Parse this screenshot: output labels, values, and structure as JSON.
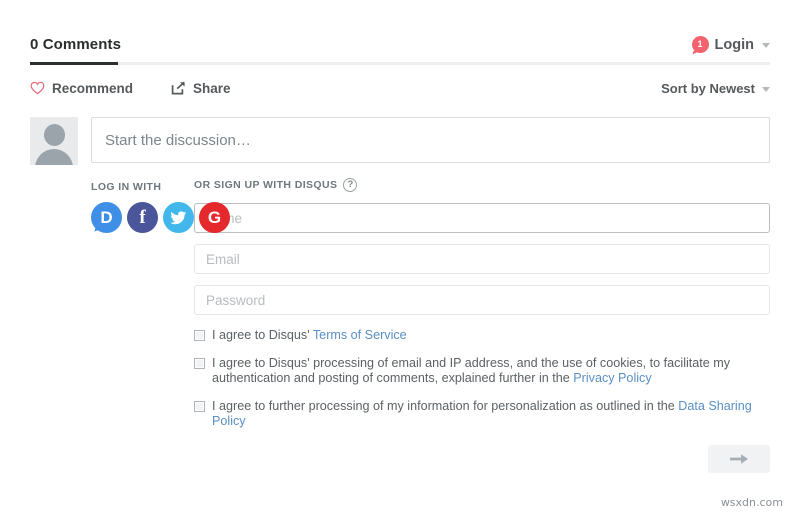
{
  "header": {
    "comment_count_label": "0 Comments",
    "login_label": "Login",
    "notification_count": "1"
  },
  "actions": {
    "recommend_label": "Recommend",
    "share_label": "Share",
    "sort_label": "Sort by Newest"
  },
  "composer": {
    "placeholder": "Start the discussion…"
  },
  "auth": {
    "login_with_label": "LOG IN WITH",
    "signup_label": "OR SIGN UP WITH DISQUS",
    "help_glyph": "?",
    "social": [
      {
        "name": "disqus",
        "glyph": "D",
        "color": "#3e8fe5"
      },
      {
        "name": "facebook",
        "glyph": "f",
        "color": "#4a5699"
      },
      {
        "name": "twitter",
        "glyph": "🐦",
        "color": "#41b7ec"
      },
      {
        "name": "google",
        "glyph": "G",
        "color": "#e4282b"
      }
    ],
    "fields": [
      {
        "name": "name",
        "placeholder": "Name"
      },
      {
        "name": "email",
        "placeholder": "Email"
      },
      {
        "name": "password",
        "placeholder": "Password"
      }
    ],
    "consents": [
      {
        "pre": "I agree to Disqus' ",
        "link": "Terms of Service",
        "post": ""
      },
      {
        "pre": "I agree to Disqus' processing of email and IP address, and the use of cookies, to facilitate my authentication and posting of comments, explained further in the ",
        "link": "Privacy Policy",
        "post": ""
      },
      {
        "pre": "I agree to further processing of my information for personalization as outlined in the ",
        "link": "Data Sharing Policy",
        "post": ""
      }
    ]
  },
  "watermark": "wsxdn.com",
  "colors": {
    "accent_red": "#f2636d",
    "link_blue": "#5a8fc4",
    "text_dark": "#2a2e2e",
    "text_muted": "#55595c"
  }
}
